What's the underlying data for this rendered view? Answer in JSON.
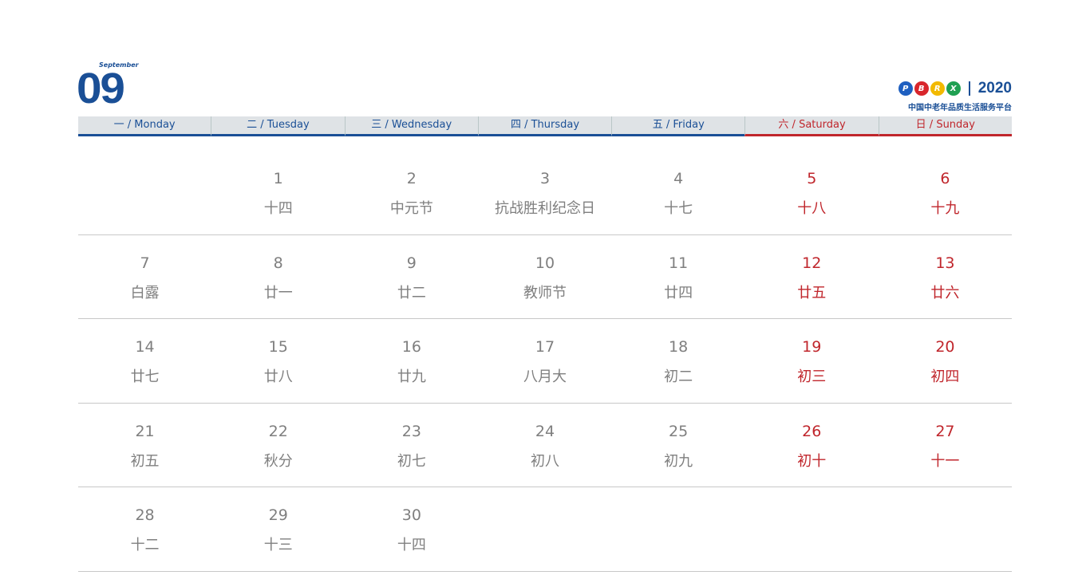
{
  "header": {
    "month_en": "September",
    "month_num": "09",
    "year": "2020",
    "slogan": "中国中老年品质生活服务平台",
    "logo": [
      {
        "letter": "P",
        "color": "#1e5fc0"
      },
      {
        "letter": "B",
        "color": "#d8262c"
      },
      {
        "letter": "R",
        "color": "#f2b900"
      },
      {
        "letter": "X",
        "color": "#1fa052"
      }
    ]
  },
  "colors": {
    "accent": "#1a4f96",
    "weekend": "#c0262c"
  },
  "weekdays": [
    {
      "label": "一 / Monday"
    },
    {
      "label": "二 / Tuesday"
    },
    {
      "label": "三 / Wednesday"
    },
    {
      "label": "四 / Thursday"
    },
    {
      "label": "五 / Friday"
    },
    {
      "label": "六 / Saturday"
    },
    {
      "label": "日 / Sunday"
    }
  ],
  "weeks": [
    [
      {
        "d": "",
        "l": ""
      },
      {
        "d": "1",
        "l": "十四"
      },
      {
        "d": "2",
        "l": "中元节"
      },
      {
        "d": "3",
        "l": "抗战胜利纪念日"
      },
      {
        "d": "4",
        "l": "十七"
      },
      {
        "d": "5",
        "l": "十八"
      },
      {
        "d": "6",
        "l": "十九"
      }
    ],
    [
      {
        "d": "7",
        "l": "白露"
      },
      {
        "d": "8",
        "l": "廿一"
      },
      {
        "d": "9",
        "l": "廿二"
      },
      {
        "d": "10",
        "l": "教师节"
      },
      {
        "d": "11",
        "l": "廿四"
      },
      {
        "d": "12",
        "l": "廿五"
      },
      {
        "d": "13",
        "l": "廿六"
      }
    ],
    [
      {
        "d": "14",
        "l": "廿七"
      },
      {
        "d": "15",
        "l": "廿八"
      },
      {
        "d": "16",
        "l": "廿九"
      },
      {
        "d": "17",
        "l": "八月大"
      },
      {
        "d": "18",
        "l": "初二"
      },
      {
        "d": "19",
        "l": "初三"
      },
      {
        "d": "20",
        "l": "初四"
      }
    ],
    [
      {
        "d": "21",
        "l": "初五"
      },
      {
        "d": "22",
        "l": "秋分"
      },
      {
        "d": "23",
        "l": "初七"
      },
      {
        "d": "24",
        "l": "初八"
      },
      {
        "d": "25",
        "l": "初九"
      },
      {
        "d": "26",
        "l": "初十"
      },
      {
        "d": "27",
        "l": "十一"
      }
    ],
    [
      {
        "d": "28",
        "l": "十二"
      },
      {
        "d": "29",
        "l": "十三"
      },
      {
        "d": "30",
        "l": "十四"
      },
      {
        "d": "",
        "l": ""
      },
      {
        "d": "",
        "l": ""
      },
      {
        "d": "",
        "l": ""
      },
      {
        "d": "",
        "l": ""
      }
    ]
  ]
}
